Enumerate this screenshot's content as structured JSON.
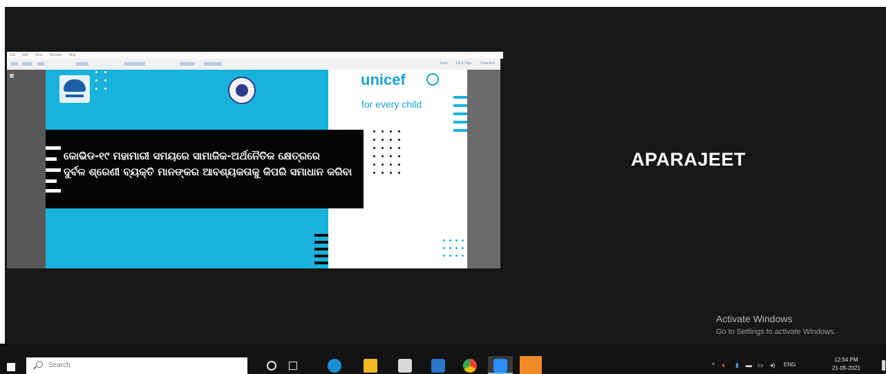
{
  "viewer": {
    "menu_items": [
      "File",
      "Edit",
      "View",
      "Window",
      "Help"
    ],
    "toolbar_right": [
      "Tools",
      "Fill & Sign",
      "Comment"
    ],
    "slide": {
      "odia_line_1": "କୋଭିଡ-୧୯ ମହାମାରୀ ସମୟରେ ସାମାଜିକ-ଅର୍ଥନୈତିକ କ୍ଷେତ୍ରରେ",
      "odia_line_2": "ଦୁର୍ବଳ ଶ୍ରେଣୀ ବ୍ୟକ୍ତି ମାନଙ୍କର ଆବଶ୍ୟକତାକୁ କିପରି ସମାଧାନ କରିବା",
      "unicef_wordmark": "unicef",
      "tagline": "for every child"
    }
  },
  "participant_name": "APARAJEET",
  "watermark": {
    "title": "Activate Windows",
    "subtitle": "Go to Settings to activate Windows."
  },
  "taskbar": {
    "search_placeholder": "Search",
    "tray_lang": "ENG",
    "time": "12:54 PM",
    "date": "21-05-2021"
  },
  "colors": {
    "slide_cyan": "#19b2dc",
    "unicef_blue": "#1aa1d8",
    "desktop_bg": "#171717"
  }
}
